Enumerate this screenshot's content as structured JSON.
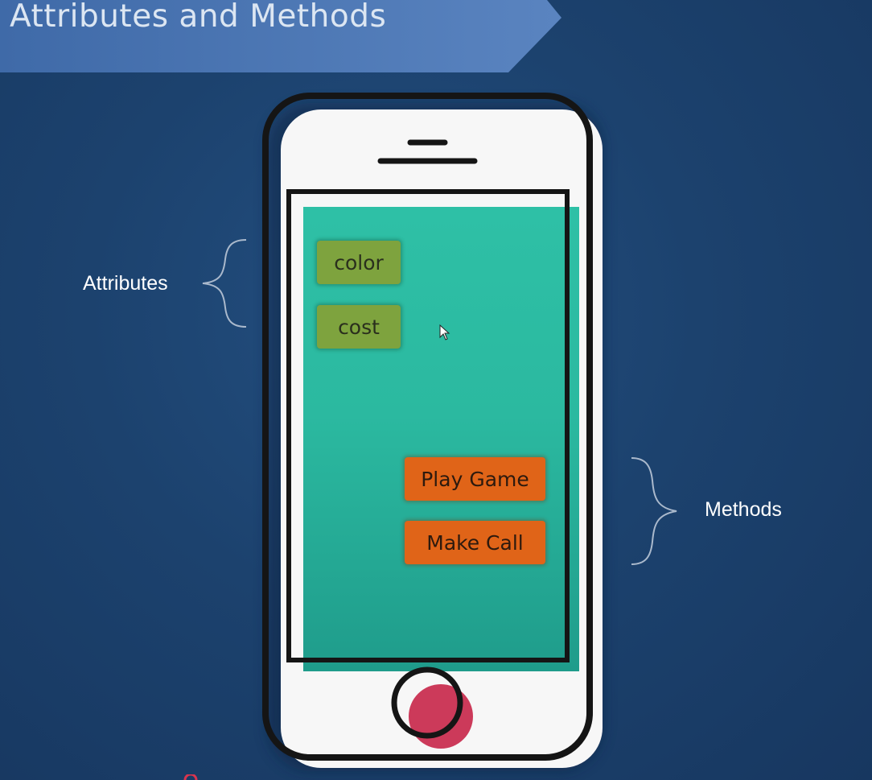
{
  "header": {
    "title": "Attributes and Methods"
  },
  "diagram": {
    "attributes_label": "Attributes",
    "methods_label": "Methods",
    "attributes": [
      "color",
      "cost"
    ],
    "methods": [
      "Play Game",
      "Make Call"
    ]
  },
  "colors": {
    "banner": "#5a84c0",
    "screen": "#2ec0a6",
    "attribute_chip": "#7ea33e",
    "method_chip": "#e06418",
    "home_button_fill": "#cc3a5a",
    "background": "#1c426e"
  },
  "icons": [
    "phone-speaker-icon",
    "home-button-icon",
    "mouse-cursor-icon",
    "curly-brace-icon"
  ]
}
